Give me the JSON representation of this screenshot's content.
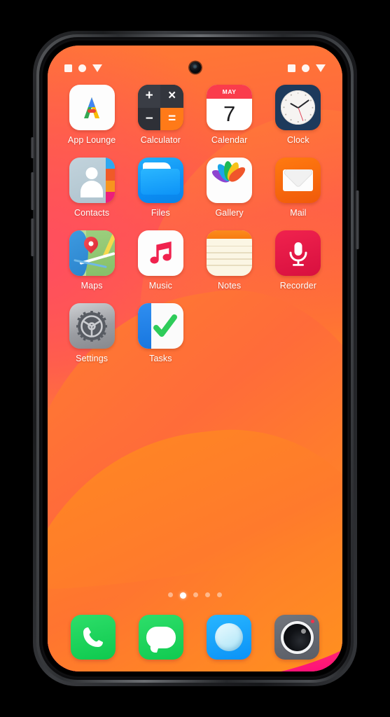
{
  "device": {
    "type": "smartphone",
    "frame_color": "#2a2b2e",
    "camera": "punch-hole-front-camera"
  },
  "status_bar": {
    "left_icons": [
      "square-icon",
      "circle-icon",
      "triangle-down-icon"
    ],
    "right_icons": [
      "square-icon",
      "circle-icon",
      "triangle-down-icon"
    ]
  },
  "wallpaper": {
    "name": "orange-pink-wave-gradient",
    "colors": [
      "#ff7a33",
      "#ff5a4a",
      "#ffa216",
      "#ff0a7a",
      "#ff3d6e"
    ]
  },
  "home_screen": {
    "apps": [
      {
        "label": "App Lounge",
        "icon": "app-lounge-icon",
        "accent": "#4285f4"
      },
      {
        "label": "Calculator",
        "icon": "calculator-icon",
        "accent": "#ff7a18",
        "keys": [
          "+",
          "×",
          "−",
          "="
        ]
      },
      {
        "label": "Calendar",
        "icon": "calendar-icon",
        "accent": "#fa3c4c",
        "month": "MAY",
        "day": "7"
      },
      {
        "label": "Clock",
        "icon": "clock-icon",
        "accent": "#1d3a5c",
        "time_shown": "10:09"
      },
      {
        "label": "Contacts",
        "icon": "contacts-icon",
        "accent": "#aec3ce"
      },
      {
        "label": "Files",
        "icon": "files-folder-icon",
        "accent": "#0b8ef5"
      },
      {
        "label": "Gallery",
        "icon": "gallery-flower-icon",
        "accent": "#ffffff"
      },
      {
        "label": "Mail",
        "icon": "mail-envelope-icon",
        "accent": "#f05a0a"
      },
      {
        "label": "Maps",
        "icon": "maps-pin-icon",
        "accent": "#9ccf7e"
      },
      {
        "label": "Music",
        "icon": "music-note-icon",
        "accent": "#f0224e"
      },
      {
        "label": "Notes",
        "icon": "notes-pad-icon",
        "accent": "#fb8b1e"
      },
      {
        "label": "Recorder",
        "icon": "recorder-microphone-icon",
        "accent": "#d8103f"
      },
      {
        "label": "Settings",
        "icon": "settings-gear-icon",
        "accent": "#9b9da2"
      },
      {
        "label": "Tasks",
        "icon": "tasks-checkmark-icon",
        "accent": "#1877e0"
      }
    ]
  },
  "page_indicator": {
    "total_pages": 5,
    "active_page": 2
  },
  "dock": {
    "items": [
      {
        "label": "Phone",
        "icon": "phone-handset-icon",
        "accent": "#0ec94e"
      },
      {
        "label": "Messages",
        "icon": "message-bubble-icon",
        "accent": "#10ca50"
      },
      {
        "label": "Browser",
        "icon": "browser-compass-icon",
        "accent": "#0b92f7"
      },
      {
        "label": "Camera",
        "icon": "camera-lens-icon",
        "accent": "#595d66"
      }
    ]
  }
}
